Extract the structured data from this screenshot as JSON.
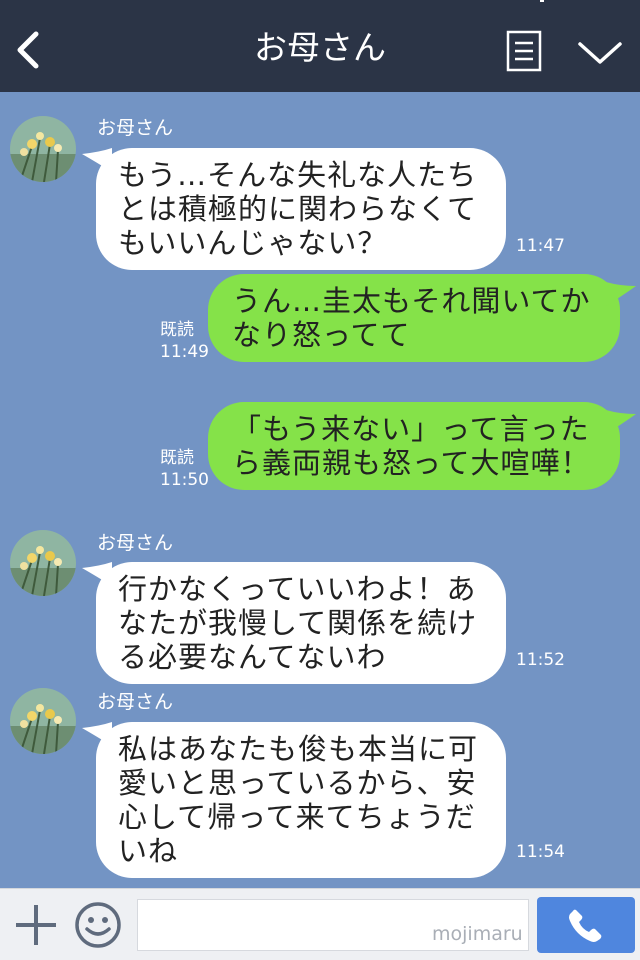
{
  "header": {
    "title": "お母さん",
    "icons": [
      "back-icon",
      "menu-icon",
      "chevron-down-icon"
    ]
  },
  "messages": [
    {
      "direction": "in",
      "sender": "お母さん",
      "lines": [
        "もう…そんな失礼な人たち",
        "とは積極的に関わらなくて",
        "もいいんじゃない？"
      ],
      "time": "11:47"
    },
    {
      "direction": "out",
      "read": "既読",
      "lines": [
        "うん…圭太もそれ聞いてか",
        "なり怒ってて"
      ],
      "time": "11:49"
    },
    {
      "direction": "out",
      "read": "既読",
      "lines": [
        "「もう来ない」って言った",
        "ら義両親も怒って大喧嘩！"
      ],
      "time": "11:50"
    },
    {
      "direction": "in",
      "sender": "お母さん",
      "lines": [
        "行かなくっていいわよ！あ",
        "なたが我慢して関係を続け",
        "る必要なんてないわ"
      ],
      "time": "11:52"
    },
    {
      "direction": "in",
      "sender": "お母さん",
      "lines": [
        "私はあなたも俊も本当に可",
        "愛いと思っているから、安",
        "心して帰って来てちょうだ",
        "いね"
      ],
      "time": "11:54"
    }
  ],
  "footer": {
    "input_value": "",
    "watermark": "mojimaru",
    "icons": [
      "plus-icon",
      "smile-icon",
      "phone-icon"
    ]
  },
  "colors": {
    "header_bg": "#2b3446",
    "chat_bg": "#7394c4",
    "outgoing_bubble": "#85e249",
    "incoming_bubble": "#ffffff",
    "call_button": "#4f86de"
  }
}
